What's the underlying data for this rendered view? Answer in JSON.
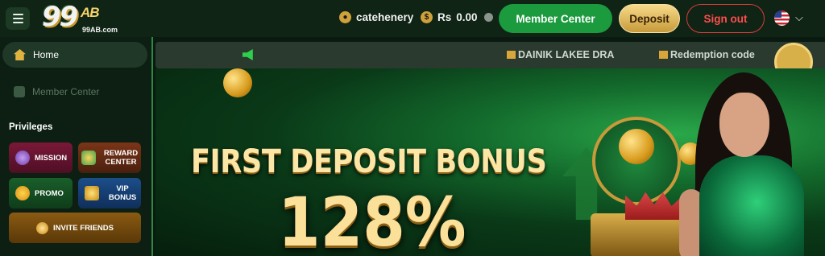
{
  "header": {
    "logo_main": "99",
    "logo_ab": "AB",
    "logo_url": "99AB.com",
    "username": "catehenery",
    "currency": "Rs",
    "balance": "0.00",
    "member_center": "Member Center",
    "deposit": "Deposit",
    "sign_out": "Sign out",
    "language": "US"
  },
  "sidebar": {
    "home": "Home",
    "member_center": "Member Center",
    "privileges_title": "Privileges",
    "mission": "MISSION",
    "reward_center": "REWARD CENTER",
    "promo": "PROMO",
    "vip_bonus": "VIP BONUS",
    "invite_friends": "INVITE FRIENDS"
  },
  "marquee": {
    "item1": "DAINIK LAKEE DRA",
    "item2": "Redemption code"
  },
  "banner": {
    "title": "FIRST DEPOSIT BONUS",
    "percent": "128%"
  },
  "colors": {
    "primary_green": "#1b9a3e",
    "gold": "#d8b04a",
    "sign_out_red": "#d83c3c"
  }
}
